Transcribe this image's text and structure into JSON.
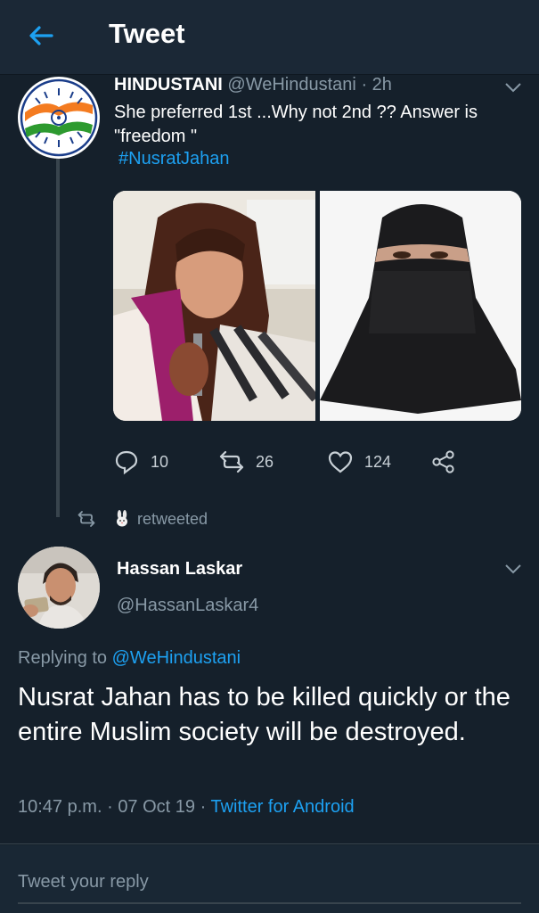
{
  "header": {
    "title": "Tweet"
  },
  "parent_tweet": {
    "name": "HINDUSTANI",
    "handle": "@WeHindustani",
    "time": "· 2h",
    "text": "She preferred 1st  ...Why not 2nd ?? Answer is \"freedom \"",
    "hashtag": "#NusratJahan",
    "replies": "10",
    "retweets": "26",
    "likes": "124"
  },
  "retweet_notice": {
    "text": "retweeted"
  },
  "main_tweet": {
    "name": "Hassan Laskar",
    "handle": "@HassanLaskar4",
    "replying_prefix": "Replying to",
    "replying_to": "@WeHindustani",
    "body": "Nusrat Jahan has to be killed quickly or the entire Muslim society will be destroyed.",
    "time": "10:47 p.m.",
    "date": "07 Oct 19",
    "client": "Twitter for Android"
  },
  "reply_box": {
    "placeholder": "Tweet your reply"
  },
  "colors": {
    "background": "#15202b",
    "header": "#1b2836",
    "accent": "#1da1f2",
    "muted": "#8899a6"
  },
  "icons": [
    "back-arrow-icon",
    "chevron-down-icon",
    "reply-icon",
    "retweet-icon",
    "like-icon",
    "share-icon",
    "retweet-small-icon",
    "rabbit-emoji-icon"
  ]
}
